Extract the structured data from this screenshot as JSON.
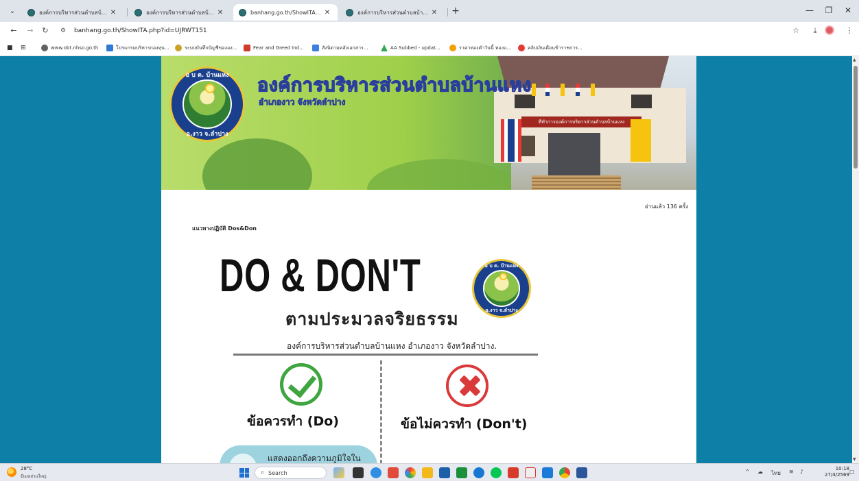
{
  "browser": {
    "tabs": [
      {
        "title": "องค์การบริหารส่วนตำบลบ้านแหง อำเ",
        "active": false
      },
      {
        "title": "องค์การบริหารส่วนตำบลบ้านแหง อำเ",
        "active": false
      },
      {
        "title": "banhang.go.th/ShowITA.php?id",
        "active": true
      },
      {
        "title": "องค์การบริหารส่วนตำบลบ้านแหง อำเ",
        "active": false
      }
    ],
    "new_tab": "+",
    "url": "banhang.go.th/ShowITA.php?id=UJRWT151",
    "bookmarks": [
      {
        "label": "www.obt.nhso.go.th",
        "color": "#5f6368"
      },
      {
        "label": "โปรแกรมบริหารกองทุน...",
        "color": "#2e7bd6"
      },
      {
        "label": "ระบบบันทึกบัญชีขององ...",
        "color": "#c9a227"
      },
      {
        "label": "Fear and Greed Ind...",
        "color": "#d03b2f"
      },
      {
        "label": "สังนิตามคลังเอกสาร...",
        "color": "#3d7fe0"
      },
      {
        "label": "AA Subbed - updat...",
        "color": "#34a853"
      },
      {
        "label": "ราคาทองคำวันนี้ ทองแ...",
        "color": "#f2a000"
      },
      {
        "label": "คลิปเงินเดือนข้าราชการ...",
        "color": "#e53935"
      }
    ]
  },
  "page": {
    "banner_title": "องค์การบริหารส่วนตำบลบ้านแหง",
    "banner_subtitle": "อำเภองาว จังหวัดลำปาง",
    "seal_top": "อ บ ต. บ้านแหง",
    "seal_bottom": "อ.งาว จ.ลำปาง",
    "building_sign": "ที่ทำการองค์การบริหารส่วนตำบลบ้านแหง",
    "read_count": "อ่านแล้ว 136 ครั้ง",
    "doc_title": "แนวทางปฏิบัติ Dos&Don",
    "infographic": {
      "heading": "DO & DON'T",
      "subheading": "ตามประมวลจริยธรรม",
      "org_line": "องค์การบริหารส่วนตำบลบ้านแหง อำเภองาว จังหวัดลำปาง.",
      "do_label": "ข้อควรทำ (Do)",
      "dont_label": "ข้อไม่ควรทำ (Don't)",
      "do_first_line": "แสดงออกถึงความภูมิใจใน"
    }
  },
  "taskbar": {
    "temperature": "28°C",
    "weather_desc": "มีเมฆส่วนใหญ่",
    "search_placeholder": "Search",
    "language": "ไทย",
    "time": "10:18",
    "date": "27/4/2569"
  },
  "colors": {
    "page_background": "#0e7fa6",
    "do_green": "#3fa53f",
    "dont_red": "#d93a3a",
    "title_stroke": "#2a3e9c"
  }
}
